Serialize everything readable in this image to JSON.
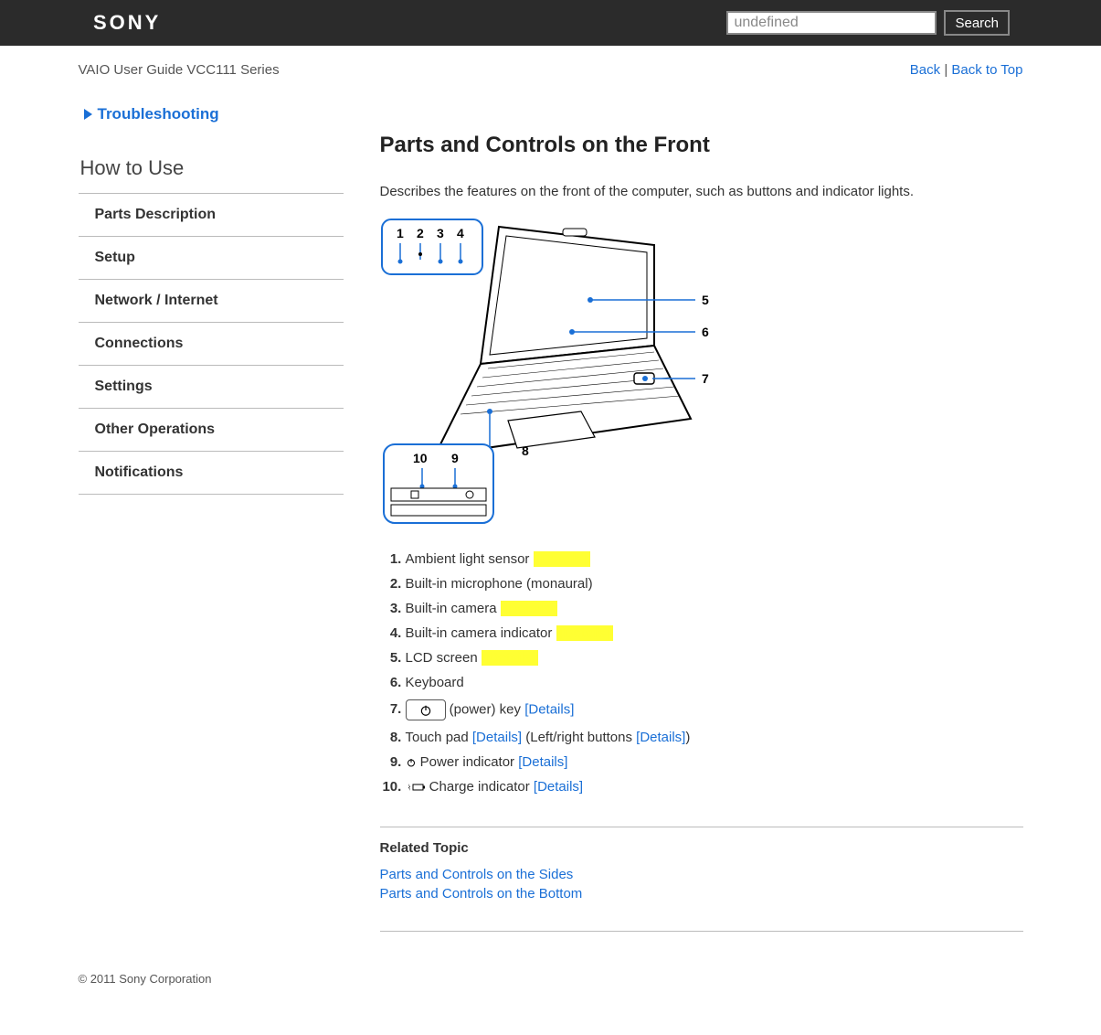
{
  "header": {
    "logo_text": "SONY",
    "search_value": "undefined",
    "search_button": "Search"
  },
  "breadcrumb": {
    "guide_title": "VAIO User Guide VCC111 Series",
    "back_label": "Back",
    "top_label": "Back to Top",
    "separator": " | "
  },
  "sidebar": {
    "troubleshooting_label": "Troubleshooting",
    "howto_label": "How to Use",
    "nav": [
      "Parts Description",
      "Setup",
      "Network / Internet",
      "Connections",
      "Settings",
      "Other Operations",
      "Notifications"
    ]
  },
  "content": {
    "title": "Parts and Controls on the Front",
    "intro": "Describes the features on the front of the computer, such as buttons and indicator lights.",
    "callout_labels": [
      "1",
      "2",
      "3",
      "4",
      "5",
      "6",
      "7",
      "8",
      "9",
      "10"
    ],
    "list": {
      "i1_text": "Ambient light sensor ",
      "i2_text": "Built-in microphone (monaural)",
      "i3_text": "Built-in camera ",
      "i4_text": "Built-in camera indicator ",
      "i5_text": "LCD screen ",
      "i6_text": "Keyboard",
      "i7_text": " (power) key ",
      "i7_link": "[Details]",
      "i8_text_a": "Touch pad ",
      "i8_link_a": "[Details]",
      "i8_text_b": " (Left/right buttons ",
      "i8_link_b": "[Details]",
      "i8_text_c": ")",
      "i9_text": " Power indicator ",
      "i9_link": "[Details]",
      "i10_text": " Charge indicator ",
      "i10_link": "[Details]",
      "hidden_placeholder": "[Details]"
    },
    "related_title": "Related Topic",
    "related_links": [
      "Parts and Controls on the Sides",
      "Parts and Controls on the Bottom"
    ]
  },
  "footer": {
    "copyright": "© 2011 Sony Corporation"
  }
}
